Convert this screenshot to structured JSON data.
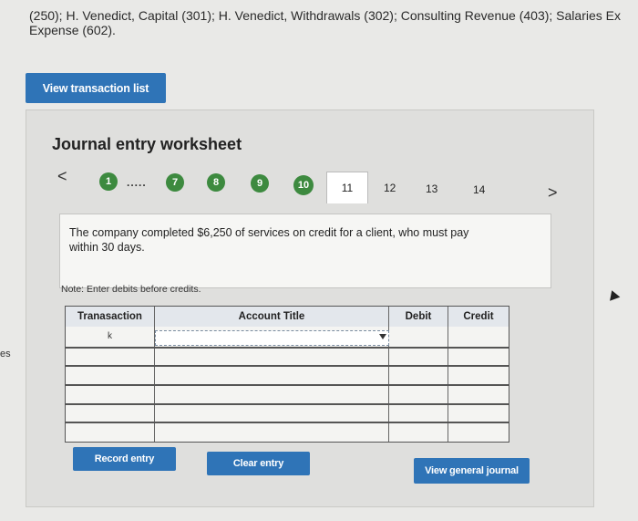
{
  "header": {
    "line1": "(250); H. Venedict, Capital (301); H. Venedict, Withdrawals (302); Consulting Revenue (403); Salaries Ex",
    "line2": "Expense (602)."
  },
  "left_fragment": "es",
  "buttons": {
    "view_transaction_list": "View transaction list",
    "record_entry": "Record entry",
    "clear_entry": "Clear entry",
    "view_general_journal": "View general journal"
  },
  "worksheet": {
    "title": "Journal entry worksheet",
    "nav_prev": "<",
    "nav_next": ">",
    "dots": ".....",
    "completed_steps": [
      "1",
      "7",
      "8",
      "9",
      "10"
    ],
    "current_tab": "11",
    "upcoming_tabs": [
      "12",
      "13",
      "14"
    ],
    "description": "The company completed $6,250 of services on credit for a client, who must pay within 30 days.",
    "note": "Note: Enter debits before credits."
  },
  "table": {
    "headers": {
      "transaction": "Tranasaction",
      "account_title": "Account Title",
      "debit": "Debit",
      "credit": "Credit"
    },
    "first_transaction_value": "k"
  },
  "colors": {
    "button_blue": "#2f74b7",
    "step_green": "#3d8a3f"
  }
}
